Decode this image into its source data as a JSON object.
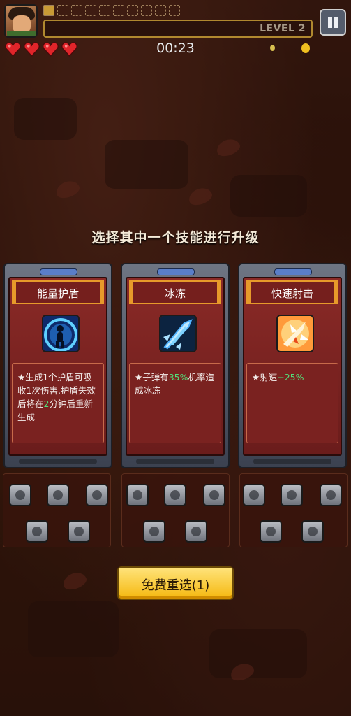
{
  "hud": {
    "level_label": "LEVEL 2",
    "timer": "00:23",
    "hearts": 4,
    "xp_slots": 10
  },
  "prompt": {
    "title": "选择其中一个技能进行升级"
  },
  "cards": [
    {
      "name": "能量护盾",
      "icon": "shield-skill-icon",
      "desc_parts": [
        "★生成1个护盾可吸收1次伤害,护盾失效后将在",
        "2",
        "分钟后重新生成"
      ]
    },
    {
      "name": "冰冻",
      "icon": "ice-shard-skill-icon",
      "desc_parts": [
        "★子弹有",
        "35%",
        "机率造成冰冻"
      ]
    },
    {
      "name": "快速射击",
      "icon": "rapid-fire-skill-icon",
      "desc_parts": [
        "★射速",
        "+25%",
        ""
      ]
    }
  ],
  "reroll": {
    "label": "免费重选(1)"
  },
  "colors": {
    "accent_gold": "#f5b80f",
    "highlight_green": "#52e07a",
    "card_red": "#8a2a27"
  }
}
